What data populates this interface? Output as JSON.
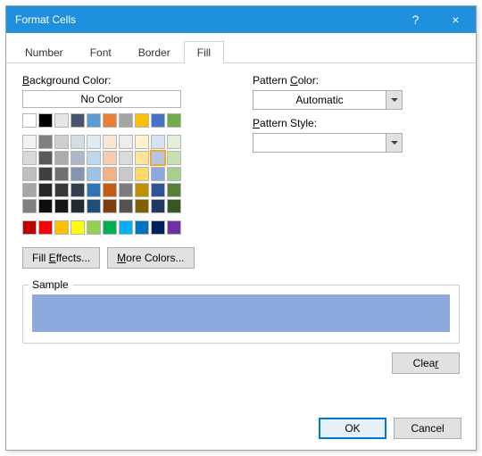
{
  "titlebar": {
    "title": "Format Cells",
    "help": "?",
    "close": "×"
  },
  "tabs": [
    "Number",
    "Font",
    "Border",
    "Fill"
  ],
  "active_tab": 3,
  "labels": {
    "bg": "Background Color:",
    "nocolor": "No Color",
    "pcolor": "Pattern Color:",
    "pstyle": "Pattern Style:",
    "fe": "Fill Effects...",
    "mc": "More Colors...",
    "sample": "Sample",
    "clear": "Clear",
    "ok": "OK",
    "cancel": "Cancel"
  },
  "pattern_color": "Automatic",
  "pattern_style": "",
  "sample_color": "#8ea9db",
  "selected_color": "#b4c6e7",
  "theme_row": [
    "#ffffff",
    "#000000",
    "#e7e6e6",
    "#44546a",
    "#5b9bd5",
    "#ed7d31",
    "#a5a5a5",
    "#ffc000",
    "#4472c4",
    "#70ad47"
  ],
  "theme_grid": [
    [
      "#f2f2f2",
      "#808080",
      "#d0cece",
      "#d6dce4",
      "#deebf6",
      "#fbe5d5",
      "#ededed",
      "#fff2cc",
      "#d9e2f3",
      "#e2efd9"
    ],
    [
      "#d9d9d9",
      "#595959",
      "#aeabab",
      "#adb9ca",
      "#bdd7ee",
      "#f7cbac",
      "#dbdbdb",
      "#fee599",
      "#b4c6e7",
      "#c5e0b3"
    ],
    [
      "#bfbfbf",
      "#404040",
      "#757070",
      "#8496b0",
      "#9cc3e5",
      "#f4b183",
      "#c9c9c9",
      "#ffd965",
      "#8ea9db",
      "#a8d08d"
    ],
    [
      "#a6a6a6",
      "#262626",
      "#3a3838",
      "#323f4f",
      "#2e75b5",
      "#c55a11",
      "#7b7b7b",
      "#bf9000",
      "#2f5496",
      "#538135"
    ],
    [
      "#808080",
      "#0d0d0d",
      "#171616",
      "#222a35",
      "#1e4e79",
      "#833c0b",
      "#525252",
      "#7f6000",
      "#1f3864",
      "#375623"
    ]
  ],
  "standard_row": [
    "#c00000",
    "#ff0000",
    "#ffc000",
    "#ffff00",
    "#92d050",
    "#00b050",
    "#00b0f0",
    "#0070c0",
    "#002060",
    "#7030a0"
  ]
}
